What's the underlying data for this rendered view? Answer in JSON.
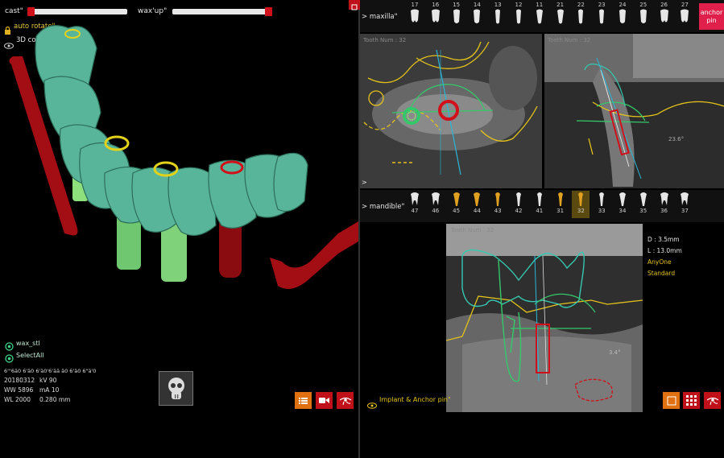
{
  "left": {
    "cast_label": "cast\"",
    "waxup_label": "wax'up\"",
    "auto_rotate": "auto rotate\"",
    "color_3d": "3D co",
    "wax_stl": "wax_stl",
    "select_all": "SelectAll",
    "patient_code": "6'\"6ä0 6'ä0 6'ä0'6'ää ä0 6'ä0 6\"ä'0",
    "scan_info": [
      [
        "20180312",
        "kV 90"
      ],
      [
        "WW 5896",
        "mA 10"
      ],
      [
        "WL 2000",
        "0.280 mm"
      ]
    ]
  },
  "right": {
    "maxilla_label": "> maxilla\"",
    "mandible_label": "> mandible\"",
    "anchor_pin": "anchor pin",
    "maxilla_teeth": [
      "17",
      "16",
      "15",
      "14",
      "13",
      "12",
      "11",
      "21",
      "22",
      "23",
      "24",
      "25",
      "26",
      "27"
    ],
    "mandible_teeth": [
      "47",
      "46",
      "45",
      "44",
      "43",
      "42",
      "41",
      "31",
      "32",
      "33",
      "34",
      "35",
      "36",
      "37"
    ],
    "selected_tooth": "32",
    "tooth_num_a": "Tooth Num : 32",
    "tooth_num_b": "Tooth Num : 32",
    "tooth_num_c": "Tooth Num : 32",
    "angle_b": "23.6°",
    "angle_c": "3.4°",
    "implant_d": "D : 3.5mm",
    "implant_l": "L : 13.0mm",
    "implant_brand": "AnyOne",
    "implant_type": "Standard",
    "implant_anchor": "Implant & Anchor pin\""
  },
  "colors": {
    "accent_red": "#d0101a",
    "accent_orange": "#e07010",
    "green_ring": "#45d47a",
    "yellow": "#e3c21a",
    "cyan": "#29b6d8"
  }
}
